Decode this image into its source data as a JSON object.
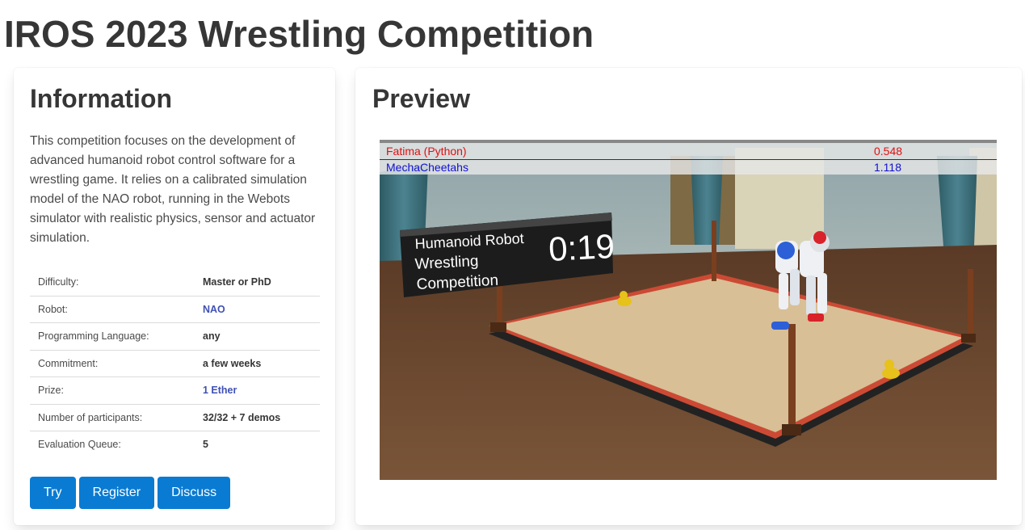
{
  "page": {
    "title": "IROS 2023 Wrestling Competition"
  },
  "information": {
    "heading": "Information",
    "description": "This competition focuses on the development of advanced humanoid robot control software for a wrestling game. It relies on a calibrated simulation model of the NAO robot, running in the Webots simulator with realistic physics, sensor and actuator simulation.",
    "rows": [
      {
        "label": "Difficulty:",
        "value": "Master or PhD"
      },
      {
        "label": "Robot:",
        "value": "NAO"
      },
      {
        "label": "Programming Language:",
        "value": "any"
      },
      {
        "label": "Commitment:",
        "value": "a few weeks"
      },
      {
        "label": "Prize:",
        "value": "1 Ether"
      },
      {
        "label": "Number of participants:",
        "value": "32/32 + 7 demos"
      },
      {
        "label": "Evaluation Queue:",
        "value": "5"
      }
    ],
    "buttons": {
      "try": "Try",
      "register": "Register",
      "discuss": "Discuss"
    }
  },
  "preview": {
    "heading": "Preview",
    "players": [
      {
        "name": "Fatima (Python)",
        "score": "0.548",
        "color": "#e01010"
      },
      {
        "name": "MechaCheetahs",
        "score": "1.118",
        "color": "#1010d0"
      }
    ],
    "scoreboard": {
      "line1": "Humanoid Robot",
      "line2": "Wrestling",
      "line3": "Competition",
      "time": "0:19"
    }
  },
  "colors": {
    "button": "#0a7bd2",
    "link": "#3f51b5"
  }
}
